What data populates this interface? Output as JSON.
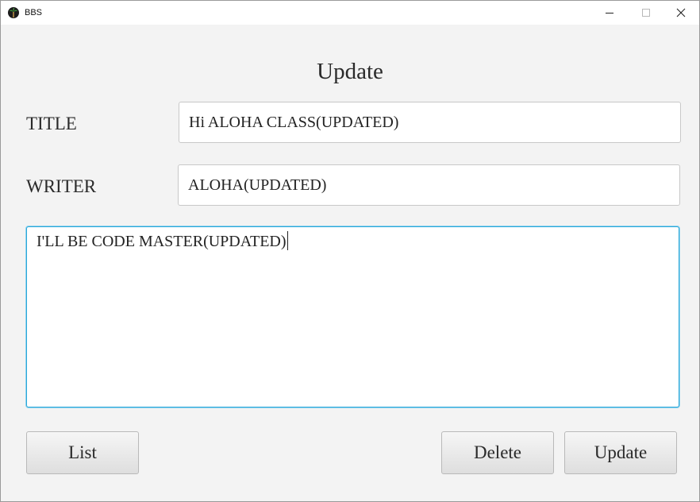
{
  "window": {
    "title": "BBS",
    "icon": "palm-tree-icon"
  },
  "form": {
    "heading": "Update",
    "title_label": "TITLE",
    "title_value": "Hi ALOHA CLASS(UPDATED)",
    "writer_label": "WRITER",
    "writer_value": "ALOHA(UPDATED)",
    "content_value": "I'LL BE CODE MASTER(UPDATED)"
  },
  "buttons": {
    "list": "List",
    "delete": "Delete",
    "update": "Update"
  },
  "colors": {
    "focus_border": "#2ba7d8",
    "background": "#f3f3f3"
  }
}
